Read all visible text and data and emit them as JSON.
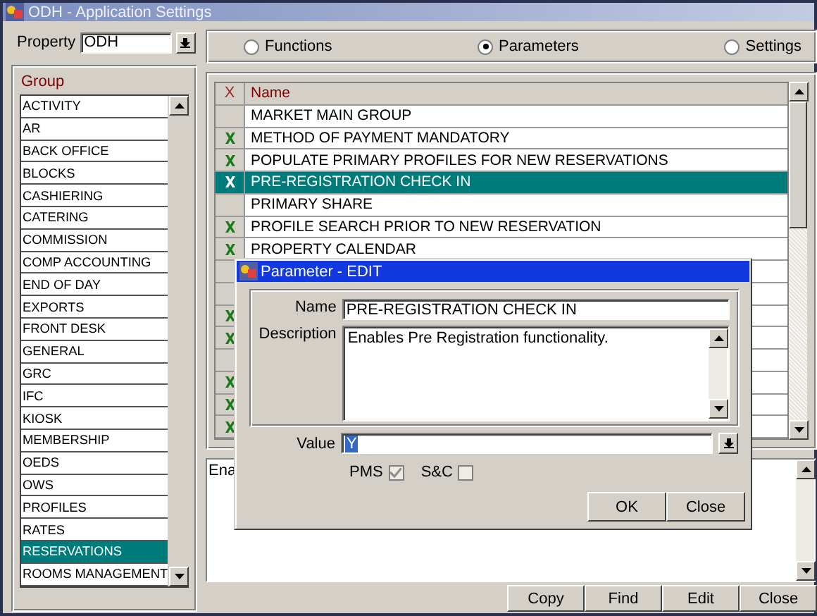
{
  "window": {
    "title": "ODH - Application Settings"
  },
  "property": {
    "label": "Property",
    "value": "ODH"
  },
  "view_options": [
    {
      "label": "Functions",
      "selected": false
    },
    {
      "label": "Parameters",
      "selected": true
    },
    {
      "label": "Settings",
      "selected": false
    }
  ],
  "group": {
    "title": "Group",
    "items": [
      {
        "label": "ACTIVITY",
        "selected": false
      },
      {
        "label": "AR",
        "selected": false
      },
      {
        "label": "BACK OFFICE",
        "selected": false
      },
      {
        "label": "BLOCKS",
        "selected": false
      },
      {
        "label": "CASHIERING",
        "selected": false
      },
      {
        "label": "CATERING",
        "selected": false
      },
      {
        "label": "COMMISSION",
        "selected": false
      },
      {
        "label": "COMP ACCOUNTING",
        "selected": false
      },
      {
        "label": "END OF DAY",
        "selected": false
      },
      {
        "label": "EXPORTS",
        "selected": false
      },
      {
        "label": "FRONT DESK",
        "selected": false
      },
      {
        "label": "GENERAL",
        "selected": false
      },
      {
        "label": "GRC",
        "selected": false
      },
      {
        "label": "IFC",
        "selected": false
      },
      {
        "label": "KIOSK",
        "selected": false
      },
      {
        "label": "MEMBERSHIP",
        "selected": false
      },
      {
        "label": "OEDS",
        "selected": false
      },
      {
        "label": "OWS",
        "selected": false
      },
      {
        "label": "PROFILES",
        "selected": false
      },
      {
        "label": "RATES",
        "selected": false
      },
      {
        "label": "RESERVATIONS",
        "selected": true
      },
      {
        "label": "ROOMS MANAGEMENT",
        "selected": false
      }
    ]
  },
  "parameters": {
    "columns": [
      "X",
      "Name"
    ],
    "rows": [
      {
        "checked": false,
        "name": "MARKET MAIN GROUP",
        "selected": false
      },
      {
        "checked": true,
        "name": "METHOD OF PAYMENT MANDATORY",
        "selected": false
      },
      {
        "checked": true,
        "name": "POPULATE PRIMARY PROFILES FOR NEW RESERVATIONS",
        "selected": false
      },
      {
        "checked": true,
        "name": "PRE-REGISTRATION CHECK IN",
        "selected": true
      },
      {
        "checked": false,
        "name": "PRIMARY SHARE",
        "selected": false
      },
      {
        "checked": true,
        "name": "PROFILE SEARCH PRIOR TO NEW RESERVATION",
        "selected": false
      },
      {
        "checked": true,
        "name": "PROPERTY CALENDAR",
        "selected": false
      },
      {
        "checked": false,
        "selected": false
      },
      {
        "checked": false,
        "selected": false
      },
      {
        "checked": true,
        "selected": false
      },
      {
        "checked": true,
        "selected": false
      },
      {
        "checked": false,
        "selected": false
      },
      {
        "checked": true,
        "selected": false
      },
      {
        "checked": true,
        "selected": false
      },
      {
        "checked": true,
        "selected": false
      }
    ]
  },
  "description": {
    "text": "Ena"
  },
  "buttons": [
    "Copy",
    "Find",
    "Edit",
    "Close"
  ],
  "dialog": {
    "title": "Parameter - EDIT",
    "name_label": "Name",
    "name": "PRE-REGISTRATION CHECK IN",
    "description_label": "Description",
    "description": "Enables Pre Registration functionality.",
    "value_label": "Value",
    "value": "Y",
    "flags": [
      {
        "label": "PMS",
        "checked": true
      },
      {
        "label": "S&C",
        "checked": false
      }
    ],
    "buttons": [
      "OK",
      "Close"
    ]
  }
}
